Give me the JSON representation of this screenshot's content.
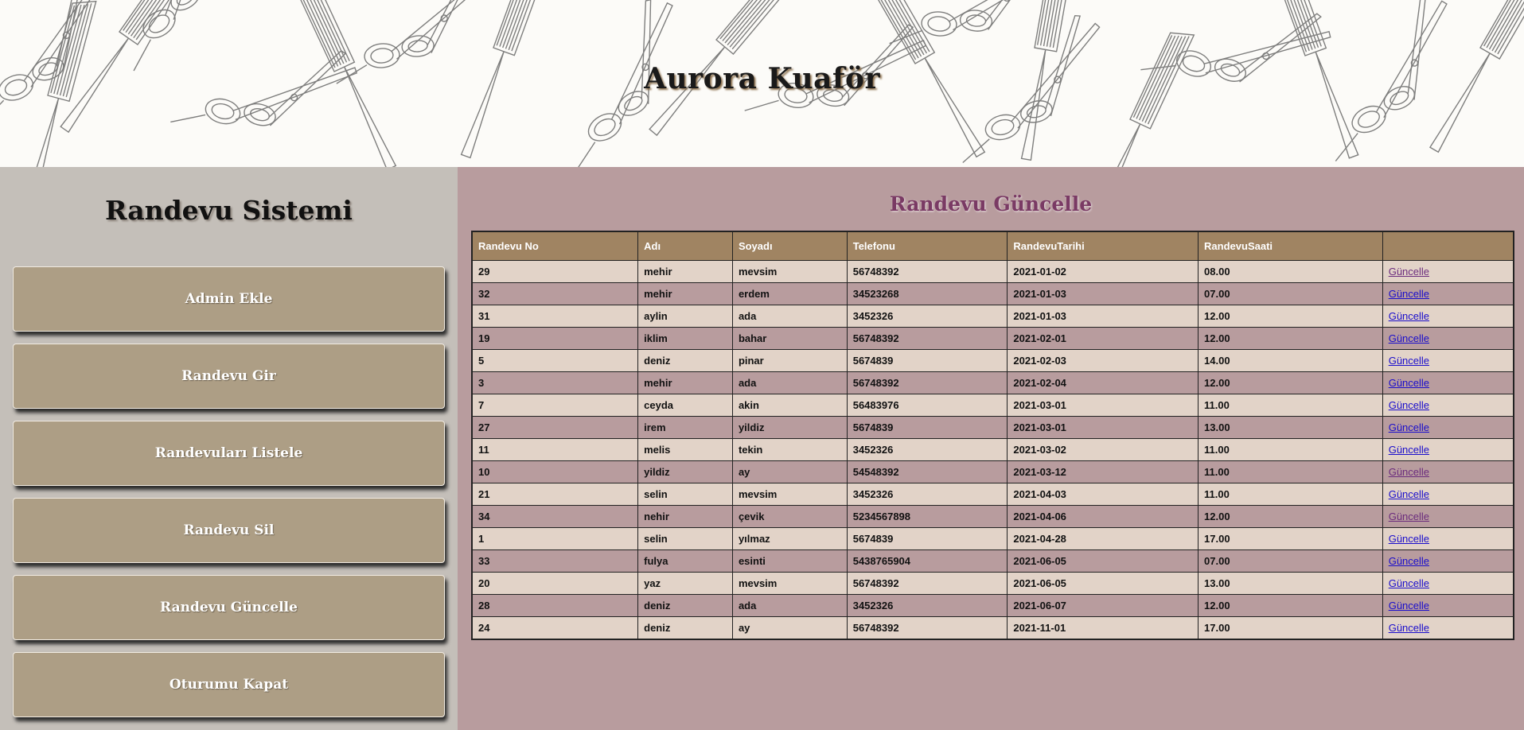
{
  "header": {
    "title": "Aurora Kuaför"
  },
  "sidebar": {
    "title": "Randevu Sistemi",
    "items": [
      {
        "label": "Admin Ekle"
      },
      {
        "label": "Randevu Gir"
      },
      {
        "label": "Randevuları Listele"
      },
      {
        "label": "Randevu Sil"
      },
      {
        "label": "Randevu Güncelle"
      },
      {
        "label": "Oturumu Kapat"
      }
    ]
  },
  "main": {
    "title": "Randevu Güncelle",
    "columns": [
      "Randevu No",
      "Adı",
      "Soyadı",
      "Telefonu",
      "RandevuTarihi",
      "RandevuSaati",
      ""
    ],
    "action_label": "Güncelle",
    "rows": [
      {
        "no": "29",
        "ad": "mehir",
        "soyad": "mevsim",
        "tel": "56748392",
        "tarih": "2021-01-02",
        "saat": "08.00",
        "visited": true
      },
      {
        "no": "32",
        "ad": "mehir",
        "soyad": "erdem",
        "tel": "34523268",
        "tarih": "2021-01-03",
        "saat": "07.00",
        "visited": false
      },
      {
        "no": "31",
        "ad": "aylin",
        "soyad": "ada",
        "tel": "3452326",
        "tarih": "2021-01-03",
        "saat": "12.00",
        "visited": false
      },
      {
        "no": "19",
        "ad": "iklim",
        "soyad": "bahar",
        "tel": "56748392",
        "tarih": "2021-02-01",
        "saat": "12.00",
        "visited": false
      },
      {
        "no": "5",
        "ad": "deniz",
        "soyad": "pinar",
        "tel": "5674839",
        "tarih": "2021-02-03",
        "saat": "14.00",
        "visited": false
      },
      {
        "no": "3",
        "ad": "mehir",
        "soyad": "ada",
        "tel": "56748392",
        "tarih": "2021-02-04",
        "saat": "12.00",
        "visited": false
      },
      {
        "no": "7",
        "ad": "ceyda",
        "soyad": "akin",
        "tel": "56483976",
        "tarih": "2021-03-01",
        "saat": "11.00",
        "visited": false
      },
      {
        "no": "27",
        "ad": "irem",
        "soyad": "yildiz",
        "tel": "5674839",
        "tarih": "2021-03-01",
        "saat": "13.00",
        "visited": false
      },
      {
        "no": "11",
        "ad": "melis",
        "soyad": "tekin",
        "tel": "3452326",
        "tarih": "2021-03-02",
        "saat": "11.00",
        "visited": false
      },
      {
        "no": "10",
        "ad": "yildiz",
        "soyad": "ay",
        "tel": "54548392",
        "tarih": "2021-03-12",
        "saat": "11.00",
        "visited": true
      },
      {
        "no": "21",
        "ad": "selin",
        "soyad": "mevsim",
        "tel": "3452326",
        "tarih": "2021-04-03",
        "saat": "11.00",
        "visited": false
      },
      {
        "no": "34",
        "ad": "nehir",
        "soyad": "çevik",
        "tel": "5234567898",
        "tarih": "2021-04-06",
        "saat": "12.00",
        "visited": true
      },
      {
        "no": "1",
        "ad": "selin",
        "soyad": "yılmaz",
        "tel": "5674839",
        "tarih": "2021-04-28",
        "saat": "17.00",
        "visited": false
      },
      {
        "no": "33",
        "ad": "fulya",
        "soyad": "esinti",
        "tel": "5438765904",
        "tarih": "2021-06-05",
        "saat": "07.00",
        "visited": false
      },
      {
        "no": "20",
        "ad": "yaz",
        "soyad": "mevsim",
        "tel": "56748392",
        "tarih": "2021-06-05",
        "saat": "13.00",
        "visited": false
      },
      {
        "no": "28",
        "ad": "deniz",
        "soyad": "ada",
        "tel": "3452326",
        "tarih": "2021-06-07",
        "saat": "12.00",
        "visited": false
      },
      {
        "no": "24",
        "ad": "deniz",
        "soyad": "ay",
        "tel": "56748392",
        "tarih": "2021-11-01",
        "saat": "17.00",
        "visited": false
      }
    ]
  }
}
